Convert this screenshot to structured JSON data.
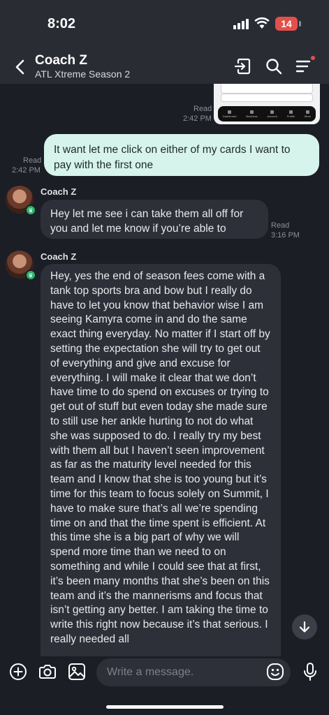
{
  "status_bar": {
    "time": "8:02",
    "battery": "14"
  },
  "header": {
    "back_icon": "chevron-left-icon",
    "title": "Coach Z",
    "subtitle": "ATL Xtreme Season 2",
    "actions": [
      "sign-in-icon",
      "search-icon",
      "menu-icon"
    ],
    "notification_color": "#e2504a"
  },
  "thumbnail": {
    "tabs": [
      "Dashboard",
      "Business",
      "Account",
      "Profile",
      "More"
    ]
  },
  "messages": [
    {
      "id": "img",
      "read_label": "Read",
      "time": "2:42 PM"
    },
    {
      "id": "out1",
      "direction": "outgoing",
      "text": "It want let me click on either of my cards I want to pay with the first one",
      "read_label": "Read",
      "time": "2:42 PM"
    },
    {
      "id": "in1",
      "direction": "incoming",
      "sender": "Coach Z",
      "text": "Hey let me see i can take them all off for you and let me know if you’re able to",
      "read_label": "Read",
      "time": "3:16 PM"
    },
    {
      "id": "in2",
      "direction": "incoming",
      "sender": "Coach Z",
      "text": "Hey, yes the end of season fees come with a tank top sports bra and bow but I really do have to let you know that behavior wise I am seeing Kamyra come in and do the same exact thing everyday. No matter if I start off by setting the expectation she will try to get out of everything and give and excuse for everything. I will make it clear that we don’t have time to do spend on excuses or trying to get out of stuff but even today she made sure to still use her ankle hurting to not do what she was supposed to do. I really try my best with them all but I haven’t seen improvement as far as the maturity level needed for this team and I know that she is too young but it’s time for this team to focus solely on Summit, I have to make sure that’s all we’re spending time on and that the time spent is efficient. At this time she is a big part of why we will spend more time than we need to on something and while I could see that at first, it’s been many months that she’s been on this team and it’s the mannerisms and focus that isn’t getting any better. I am taking the time to write this right now because it’s that serious. I really needed all"
    }
  ],
  "composer": {
    "placeholder": "Write a message.",
    "icons": [
      "plus-circle-icon",
      "camera-icon",
      "gallery-icon",
      "emoji-icon",
      "microphone-icon"
    ]
  },
  "colors": {
    "outgoing_bubble": "#d7f4ec",
    "incoming_bubble": "#2e3039",
    "background": "#1c1e26",
    "online_badge": "#2cb16b"
  }
}
